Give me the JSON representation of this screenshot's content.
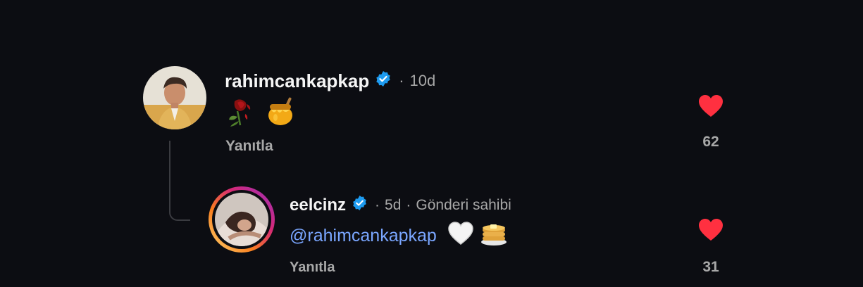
{
  "comments": [
    {
      "username": "rahimcankapkap",
      "separator": "·",
      "age": "10d",
      "owner_label": "",
      "mention": "",
      "emojis": [
        "wilted-rose",
        "honey-pot"
      ],
      "reply_label": "Yanıtla",
      "like_count": "62",
      "verified": true
    },
    {
      "username": "eelcinz",
      "separator": "·",
      "age": "5d",
      "owner_separator": "·",
      "owner_label": "Gönderi sahibi",
      "mention": "@rahimcankapkap",
      "emojis": [
        "white-heart",
        "pancakes"
      ],
      "reply_label": "Yanıtla",
      "like_count": "31",
      "verified": true,
      "has_story_ring": true
    }
  ],
  "colors": {
    "background": "#0c0d12",
    "verified_blue": "#1d9bf0",
    "like_red": "#ff3040",
    "mention_blue": "#7aa6ff",
    "meta_gray": "#a8a8a8"
  }
}
